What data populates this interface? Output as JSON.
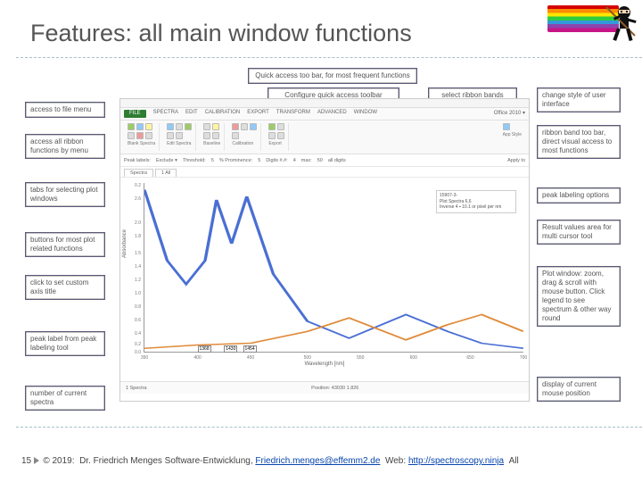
{
  "slide": {
    "title": "Features: all main window functions",
    "page_number": "15"
  },
  "footer": {
    "copyright": "© 2019:",
    "author": "Dr. Friedrich Menges Software-Entwicklung,",
    "email": "Friedrich.menges@effemm2.de",
    "web_label": "Web:",
    "web_url": "http://spectroscopy.ninja",
    "tail": "All"
  },
  "callouts": {
    "quick_access": "Quick access too bar, for most frequent functions",
    "config_quick": "Configure quick access toolbar",
    "select_bands": "select ribbon bands",
    "change_style": "change style of user interface",
    "file_menu": "access to file menu",
    "ribbon_menu": "access all ribbon functions by menu",
    "tabs": "tabs for selecting plot windows",
    "buttons": "buttons for most plot related functions",
    "axis_title": "click to set custom axis title",
    "peak_label": "peak label from peak labeling tool",
    "count": "number of current spectra",
    "ribbon_band": "ribbon band too bar, direct visual access to most functions",
    "peak_options": "peak labeling options",
    "result_area": "Result values area for multi cursor tool",
    "plot_window": "Plot window: zoom, drag & scroll with mouse button. Click legend to see spectrum & other way round",
    "mouse_pos": "display of current mouse position"
  },
  "app": {
    "menu": {
      "file": "FILE",
      "items": [
        "FILE",
        "SPECTRA",
        "EDIT",
        "CALIBRATION",
        "EXPORT",
        "TRANSFORM",
        "ADVANCED",
        "WINDOW"
      ]
    },
    "ribbon_groups": [
      "Blank Spectra",
      "Edit Spectra",
      "Baseline",
      "Calibration",
      "Export"
    ],
    "ribbon_right": {
      "scheme": "Office 2010 ▾",
      "appstyle": "App Style"
    },
    "toolbar": {
      "peak_labels": "Peak labels:",
      "exclude": "Exclude ▾",
      "threshold_lbl": "Threshold:",
      "threshold_val": "5",
      "prominence_lbl": "% Prominence:",
      "prominence_val": "5",
      "digits_lbl": "Digits #.#:",
      "digits_val": "4",
      "max_lbl": "max:",
      "max_val": "50",
      "alldigits": "all digits",
      "apply_to": "Apply to"
    },
    "tabs": {
      "spectra": "Spectra",
      "all": "1 All"
    },
    "plot": {
      "ylabel": "Absorbance",
      "xlabel": "Wavelength [nm]",
      "legend": [
        "15907-3-",
        "Plot Spectra 6,6",
        "Inverse 4 ▪ 10.1 or pixel per nm"
      ],
      "y_ticks": [
        "0.2",
        "2.6",
        "2.0",
        "1.8",
        "1.5",
        "1.4",
        "1.2",
        "1.0",
        "0.8",
        "0.6",
        "0.4",
        "0.2",
        "0.0"
      ],
      "x_ticks": [
        "350",
        "400",
        "450",
        "500",
        "550",
        "600",
        "650",
        "700"
      ],
      "peak_markers": [
        "1368",
        "1430",
        "1454"
      ]
    },
    "status": {
      "left": "1 Spectra",
      "center": "Position: 43030  1.826"
    }
  },
  "chart_data": {
    "type": "line",
    "title": "",
    "xlabel": "Wavelength [nm]",
    "ylabel": "Absorbance",
    "xlim": [
      350,
      700
    ],
    "ylim": [
      0.0,
      2.8
    ],
    "series": [
      {
        "name": "15907-3 (blue)",
        "x": [
          350,
          370,
          390,
          405,
          415,
          430,
          445,
          470,
          500,
          540,
          590,
          630,
          660,
          700
        ],
        "y": [
          2.7,
          1.5,
          1.1,
          1.5,
          2.5,
          1.8,
          2.6,
          1.3,
          0.5,
          0.22,
          0.6,
          0.35,
          0.15,
          0.05
        ]
      },
      {
        "name": "Inverse (orange)",
        "x": [
          350,
          400,
          450,
          500,
          540,
          590,
          630,
          660,
          700
        ],
        "y": [
          0.05,
          0.1,
          0.15,
          0.35,
          0.55,
          0.2,
          0.45,
          0.6,
          0.35
        ]
      }
    ],
    "peak_labels": [
      {
        "x": 405,
        "label": "1368"
      },
      {
        "x": 430,
        "label": "1430"
      },
      {
        "x": 445,
        "label": "1454"
      }
    ]
  }
}
